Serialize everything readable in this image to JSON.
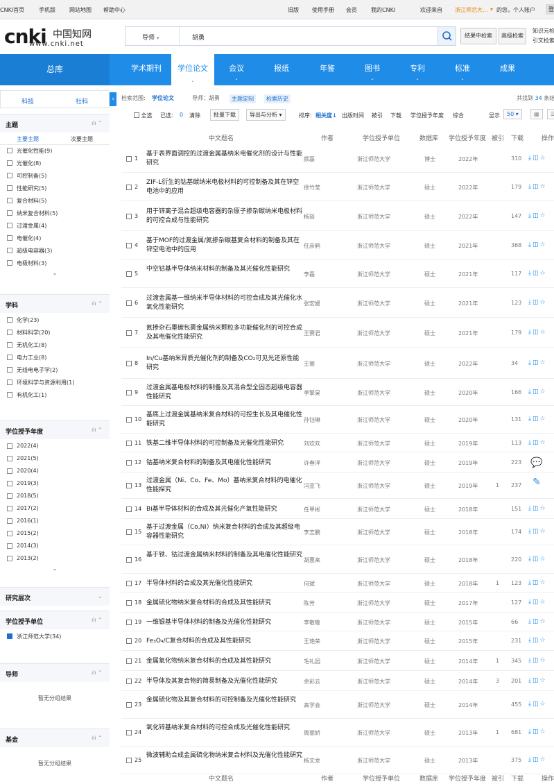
{
  "topbar": {
    "items": [
      "CNKI首页",
      "手机版",
      "网站地图",
      "帮助中心",
      "旧版",
      "使用手册",
      "会员",
      "我的CNKI",
      "欢迎来自",
      "浙江师范大...",
      "的您，个人账户"
    ],
    "login": "登"
  },
  "logo": {
    "big": "cnki",
    "cn": "中国知网",
    "url": "www.cnki.net"
  },
  "search": {
    "field": "导师",
    "value": "胡勇",
    "result_search": "结果中检索",
    "advanced": "高级检索"
  },
  "header_right": {
    "line1": "知识元检",
    "line2": "引文检索"
  },
  "nav": {
    "home": "总库",
    "tabs": [
      "学术期刊",
      "学位论文",
      "会议",
      "报纸",
      "年鉴",
      "图书",
      "专利",
      "标准",
      "成果"
    ]
  },
  "left_tabs": {
    "a": "科技",
    "b": "社科"
  },
  "topic": {
    "title": "主题",
    "sub1": "主要主题",
    "sub2": "次要主题",
    "items": [
      "光催化性能(9)",
      "光催化(8)",
      "可控制备(5)",
      "性能研究(5)",
      "复合材料(5)",
      "纳米复合材料(5)",
      "过渡金属(4)",
      "电催化(4)",
      "超级电容器(3)",
      "电极材料(3)"
    ]
  },
  "discipline": {
    "title": "学科",
    "items": [
      "化学(23)",
      "材料科学(20)",
      "无机化工(8)",
      "电力工业(8)",
      "无线电电子学(2)",
      "环境科学与资源利用(1)",
      "有机化工(1)"
    ]
  },
  "year": {
    "title": "学位授予年度",
    "items": [
      "2022(4)",
      "2021(5)",
      "2020(4)",
      "2019(3)",
      "2018(5)",
      "2017(2)",
      "2016(1)",
      "2015(2)",
      "2014(3)",
      "2013(2)"
    ]
  },
  "level": {
    "title": "研究层次"
  },
  "unit": {
    "title": "学位授予单位",
    "items": [
      "浙江师范大学(34)"
    ]
  },
  "advisor": {
    "title": "导师",
    "empty": "暂无分组结果"
  },
  "fund": {
    "title": "基金",
    "empty": "暂无分组结果"
  },
  "crumb": {
    "label": "检索范围:",
    "scope": "学位论文",
    "cond": "导师：胡勇",
    "custom": "主题定制",
    "history": "检索历史",
    "found_pre": "共找到",
    "found": "34",
    "found_post": "条结"
  },
  "toolbar": {
    "all": "全选",
    "selected": "已选:",
    "count": "0",
    "clear": "清除",
    "batch": "批量下载",
    "export": "导出与分析 ▾",
    "sort": "排序:",
    "sort_rel": "相关度↓",
    "sort_time": "出版时间",
    "sort_cite": "被引",
    "sort_dl": "下载",
    "sort_year": "学位授予年度",
    "sort_all": "综合",
    "show": "显示",
    "show_n": "50 ▾"
  },
  "thead": {
    "title": "中文题名",
    "author": "作者",
    "unit": "学位授予单位",
    "db": "数据库",
    "year": "学位授予年度",
    "cite": "被引",
    "dl": "下载",
    "ops": "操作"
  },
  "rows": [
    {
      "n": "1",
      "t": "基于表界面调控的过渡金属基纳米电催化剂的设计与性能研究",
      "a": "颜磊",
      "u": "浙江师范大学",
      "d": "博士",
      "y": "2022年",
      "c": "",
      "l": "310"
    },
    {
      "n": "2",
      "t": "ZIF-L衍生的钴基碳纳米电极材料的可控制备及其在锌空电池中的应用",
      "a": "徐竹莹",
      "u": "浙江师范大学",
      "d": "硕士",
      "y": "2022年",
      "c": "",
      "l": "179"
    },
    {
      "n": "3",
      "t": "用于锌离子混合超级电容器的杂原子掺杂碳纳米电极材料的可控合成与性能研究",
      "a": "杨琰",
      "u": "浙江师范大学",
      "d": "硕士",
      "y": "2022年",
      "c": "",
      "l": "147"
    },
    {
      "n": "4",
      "t": "基于MOF的过渡金属/氮掺杂碳基复合材料的制备及其在锌空电池中的应用",
      "a": "任彦鹤",
      "u": "浙江师范大学",
      "d": "硕士",
      "y": "2021年",
      "c": "",
      "l": "368"
    },
    {
      "n": "5",
      "t": "中空钴基半导体纳米材料的制备及其光催化性能研究",
      "a": "李磊",
      "u": "浙江师范大学",
      "d": "硕士",
      "y": "2021年",
      "c": "",
      "l": "117"
    },
    {
      "n": "6",
      "t": "过渡金属基一维纳米半导体材料的可控合成及其光催化水氧化性能研究",
      "a": "张宏媛",
      "u": "浙江师范大学",
      "d": "硕士",
      "y": "2021年",
      "c": "",
      "l": "123"
    },
    {
      "n": "7",
      "t": "氮掺杂石墨碳包裹金属纳米颗粒多功能催化剂的可控合成及其电催化性能研究",
      "a": "王赛君",
      "u": "浙江师范大学",
      "d": "硕士",
      "y": "2021年",
      "c": "",
      "l": "179"
    },
    {
      "n": "8",
      "t": "In/Cu基纳米异质光催化剂的制备及CO₂可见光还原性能研究",
      "a": "王丽",
      "u": "浙江师范大学",
      "d": "硕士",
      "y": "2022年",
      "c": "",
      "l": "34"
    },
    {
      "n": "9",
      "t": "过渡金属基电极材料的制备及其混合型全固态超级电容器性能研究",
      "a": "李擎昊",
      "u": "浙江师范大学",
      "d": "硕士",
      "y": "2020年",
      "c": "",
      "l": "166"
    },
    {
      "n": "10",
      "t": "基底上过渡金属基纳米复合材料的可控生长及其电催化性能研究",
      "a": "孙钰琳",
      "u": "浙江师范大学",
      "d": "硕士",
      "y": "2020年",
      "c": "",
      "l": "131"
    },
    {
      "n": "11",
      "t": "铁基二维半导体材料的可控制备及光催化性能研究",
      "a": "刘欢欢",
      "u": "浙江师范大学",
      "d": "硕士",
      "y": "2019年",
      "c": "",
      "l": "113"
    },
    {
      "n": "12",
      "t": "钴基纳米复合材料的制备及其电催化性能研究",
      "a": "许春洋",
      "u": "浙江师范大学",
      "d": "硕士",
      "y": "2019年",
      "c": "",
      "l": "223"
    },
    {
      "n": "13",
      "t": "过渡金属（Ni、Co、Fe、Mo）基纳米复合材料的电催化性能探究",
      "a": "冯亚飞",
      "u": "浙江师范大学",
      "d": "硕士",
      "y": "2019年",
      "c": "1",
      "l": "237"
    },
    {
      "n": "14",
      "t": "Bi基半导体材料的合成及其光催化产氧性能研究",
      "a": "任甲彬",
      "u": "浙江师范大学",
      "d": "硕士",
      "y": "2018年",
      "c": "",
      "l": "151"
    },
    {
      "n": "15",
      "t": "基于过渡金属（Co,Ni）纳米复合材料的合成及其超级电容器性能研究",
      "a": "李志鹏",
      "u": "浙江师范大学",
      "d": "硕士",
      "y": "2018年",
      "c": "",
      "l": "174"
    },
    {
      "n": "16",
      "t": "基于铁、钴过渡金属纳米材料的制备及其电催化性能研究",
      "a": "胡惠来",
      "u": "浙江师范大学",
      "d": "硕士",
      "y": "2018年",
      "c": "",
      "l": "220"
    },
    {
      "n": "17",
      "t": "半导体材料的合成及其光催化性能研究",
      "a": "何斌",
      "u": "浙江师范大学",
      "d": "硕士",
      "y": "2018年",
      "c": "1",
      "l": "123"
    },
    {
      "n": "18",
      "t": "金属硫化物纳米复合材料的合成及其性能研究",
      "a": "陈芳",
      "u": "浙江师范大学",
      "d": "硕士",
      "y": "2017年",
      "c": "",
      "l": "127"
    },
    {
      "n": "19",
      "t": "一维银基半导体材料的制备及光催化性能研究",
      "a": "李敬敬",
      "u": "浙江师范大学",
      "d": "硕士",
      "y": "2015年",
      "c": "",
      "l": "66"
    },
    {
      "n": "20",
      "t": "Fe₃O₄/C复合材料的合成及其性能研究",
      "a": "王艳荣",
      "u": "浙江师范大学",
      "d": "硕士",
      "y": "2015年",
      "c": "",
      "l": "231"
    },
    {
      "n": "21",
      "t": "金属氧化物纳米复合材料的合成及其性能研究",
      "a": "毛礼园",
      "u": "浙江师范大学",
      "d": "硕士",
      "y": "2014年",
      "c": "1",
      "l": "345"
    },
    {
      "n": "22",
      "t": "半导体及其复合物的简易制备及光催化性能研究",
      "a": "余彩云",
      "u": "浙江师范大学",
      "d": "硕士",
      "y": "2014年",
      "c": "3",
      "l": "201"
    },
    {
      "n": "23",
      "t": "金属硫化物及其复合材料的可控制备及光催化性能研究",
      "a": "高学会",
      "u": "浙江师范大学",
      "d": "硕士",
      "y": "2014年",
      "c": "",
      "l": "455"
    },
    {
      "n": "24",
      "t": "氧化锌基纳米复合材料的可控合成及光催化性能研究",
      "a": "周丽娇",
      "u": "浙江师范大学",
      "d": "硕士",
      "y": "2013年",
      "c": "1",
      "l": "681"
    },
    {
      "n": "25",
      "t": "微波辅助合成金属硫化物纳米复合材料及光催化性能研究",
      "a": "杨文龙",
      "u": "浙江师范大学",
      "d": "硕士",
      "y": "2013年",
      "c": "",
      "l": "375"
    }
  ],
  "colors": {
    "primary": "#1f8ce8",
    "nav_bg": "#1f8ce8",
    "link": "#1f6fce"
  }
}
